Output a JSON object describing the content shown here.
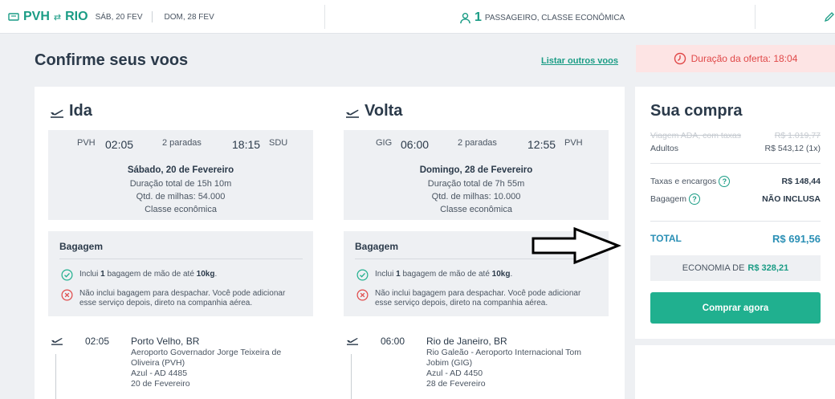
{
  "topbar": {
    "origin": "PVH",
    "destination": "RIO",
    "depart_date": "SÁB, 20 FEV",
    "return_date": "DOM, 28 FEV",
    "passenger_count": "1",
    "passenger_text": "PASSAGEIRO, CLASSE ECONÔMICA"
  },
  "page": {
    "title": "Confirme seus voos",
    "list_link": "Listar outros voos",
    "offer_text": "Duração da oferta: 18:04"
  },
  "ida": {
    "heading": "Ida",
    "from_code": "PVH",
    "depart_time": "02:05",
    "stops": "2 paradas",
    "arrive_time": "18:15",
    "to_code": "SDU",
    "date": "Sábado, 20 de Fevereiro",
    "duration": "Duração total de 15h 10m",
    "miles": "Qtd. de milhas: 54.000",
    "cabin": "Classe econômica",
    "baggage_title": "Bagagem",
    "bag_included_pre": "Inclui ",
    "bag_included_count": "1",
    "bag_included_mid": " bagagem de mão de até ",
    "bag_included_weight": "10kg",
    "bag_included_end": ".",
    "bag_excluded": "Não inclui bagagem para despachar. Você pode adicionar esse serviço depois, direto na companhia aérea.",
    "segment_time": "02:05",
    "segment_city": "Porto Velho, BR",
    "segment_airport": "Aeroporto Governador Jorge Teixeira de Oliveira (PVH)",
    "segment_flight": "Azul - AD 4485",
    "segment_date": "20 de Fevereiro"
  },
  "volta": {
    "heading": "Volta",
    "from_code": "GIG",
    "depart_time": "06:00",
    "stops": "2 paradas",
    "arrive_time": "12:55",
    "to_code": "PVH",
    "date": "Domingo, 28 de Fevereiro",
    "duration": "Duração total de 7h 55m",
    "miles": "Qtd. de milhas: 10.000",
    "cabin": "Classe econômica",
    "baggage_title": "Bagagem",
    "bag_included_pre": "Inclui ",
    "bag_included_count": "1",
    "bag_included_mid": " bagagem de mão de até ",
    "bag_included_weight": "10kg",
    "bag_included_end": ".",
    "bag_excluded": "Não inclui bagagem para despachar. Você pode adicionar esse serviço depois, direto na companhia aérea.",
    "segment_time": "06:00",
    "segment_city": "Rio de Janeiro, BR",
    "segment_airport": "Rio Galeão - Aeroporto Internacional Tom Jobim (GIG)",
    "segment_flight": "Azul - AD 4450",
    "segment_date": "28 de Fevereiro"
  },
  "purchase": {
    "title": "Sua compra",
    "strike_label": "Viagem ADA, com taxas",
    "strike_value": "R$ 1.019,77",
    "adults_label": "Adultos",
    "adults_value": "R$ 543,12 (1x)",
    "taxes_label": "Taxas e encargos",
    "taxes_value": "R$ 148,44",
    "baggage_label": "Bagagem",
    "baggage_value": "NÃO INCLUSA",
    "total_label": "TOTAL",
    "total_value": "R$ 691,56",
    "savings_label": "ECONOMIA DE",
    "savings_value": "R$ 328,21",
    "buy_button": "Comprar agora"
  },
  "colors": {
    "accent": "#1a9c85",
    "button": "#20b08f",
    "total": "#2a8fb5",
    "alert": "#e04848",
    "alert_bg": "#fde4e4"
  }
}
